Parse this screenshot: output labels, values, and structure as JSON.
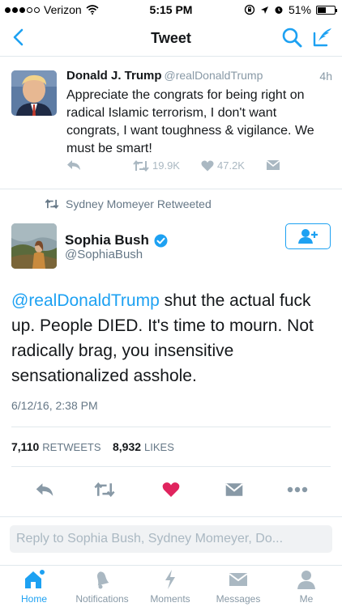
{
  "status_bar": {
    "carrier": "Verizon",
    "time": "5:15 PM",
    "battery": "51%",
    "battery_level": 0.51
  },
  "nav": {
    "title": "Tweet",
    "back_icon": "chevron-left-icon",
    "search_icon": "search-icon",
    "compose_icon": "compose-icon"
  },
  "parent_tweet": {
    "name": "Donald J. Trump",
    "handle": "@realDonaldTrump",
    "time": "4h",
    "text": "Appreciate the congrats for being right on radical Islamic terrorism, I don't want congrats, I want toughness & vigilance. We must be smart!",
    "retweets": "19.9K",
    "likes": "47.2K"
  },
  "retweeted_by": "Sydney Momeyer Retweeted",
  "tweet": {
    "name": "Sophia Bush",
    "handle": "@SophiaBush",
    "mention": "@realDonaldTrump",
    "text": " shut the actual fuck up. People DIED. It's time to mourn. Not radically brag, you insensitive sensationalized asshole.",
    "date": "6/12/16, 2:38 PM",
    "retweets_count": "7,110",
    "retweets_label": "RETWEETS",
    "likes_count": "8,932",
    "likes_label": "LIKES"
  },
  "reply": {
    "placeholder": "Reply to Sophia Bush, Sydney Momeyer, Do..."
  },
  "tabs": [
    {
      "label": "Home",
      "icon": "home-icon",
      "active": true
    },
    {
      "label": "Notifications",
      "icon": "bell-icon",
      "active": false
    },
    {
      "label": "Moments",
      "icon": "lightning-icon",
      "active": false
    },
    {
      "label": "Messages",
      "icon": "envelope-icon",
      "active": false
    },
    {
      "label": "Me",
      "icon": "person-icon",
      "active": false
    }
  ],
  "colors": {
    "accent": "#1da1f2",
    "like_active": "#e0245e",
    "muted": "#aab8c2"
  }
}
